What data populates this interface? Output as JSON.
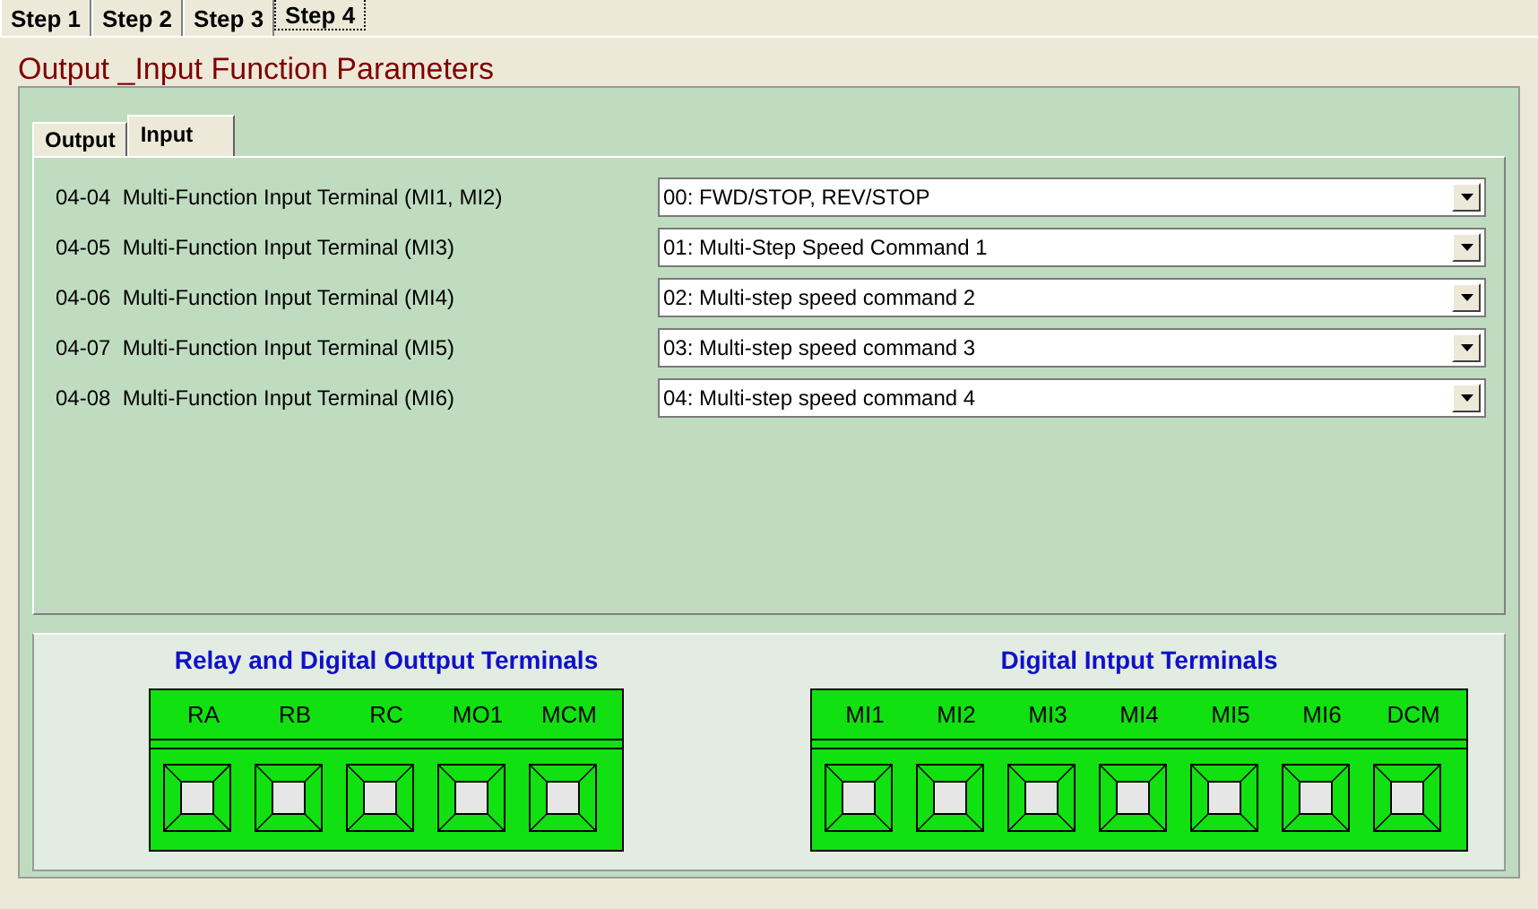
{
  "step_tabs": [
    {
      "label": "Step 1",
      "selected": false
    },
    {
      "label": "Step 2",
      "selected": false
    },
    {
      "label": "Step 3",
      "selected": false
    },
    {
      "label": "Step 4",
      "selected": true
    }
  ],
  "title": "Output _Input Function Parameters",
  "sub_tabs": [
    {
      "label": "Output",
      "selected": false
    },
    {
      "label": "Input",
      "selected": true
    }
  ],
  "parameters": [
    {
      "label": "04-04  Multi-Function Input Terminal (MI1, MI2)",
      "value": "00: FWD/STOP, REV/STOP"
    },
    {
      "label": "04-05  Multi-Function Input Terminal (MI3)",
      "value": "01: Multi-Step Speed Command 1"
    },
    {
      "label": "04-06  Multi-Function Input Terminal (MI4)",
      "value": "02: Multi-step speed command 2"
    },
    {
      "label": "04-07  Multi-Function Input Terminal (MI5)",
      "value": "03: Multi-step speed command 3"
    },
    {
      "label": "04-08  Multi-Function Input Terminal (MI6)",
      "value": "04: Multi-step speed command 4"
    }
  ],
  "terminal_groups": [
    {
      "title": "Relay and Digital Outtput Terminals",
      "terminals": [
        "RA",
        "RB",
        "RC",
        "MO1",
        "MCM"
      ]
    },
    {
      "title": "Digital Intput Terminals",
      "terminals": [
        "MI1",
        "MI2",
        "MI3",
        "MI4",
        "MI5",
        "MI6",
        "DCM"
      ]
    }
  ]
}
